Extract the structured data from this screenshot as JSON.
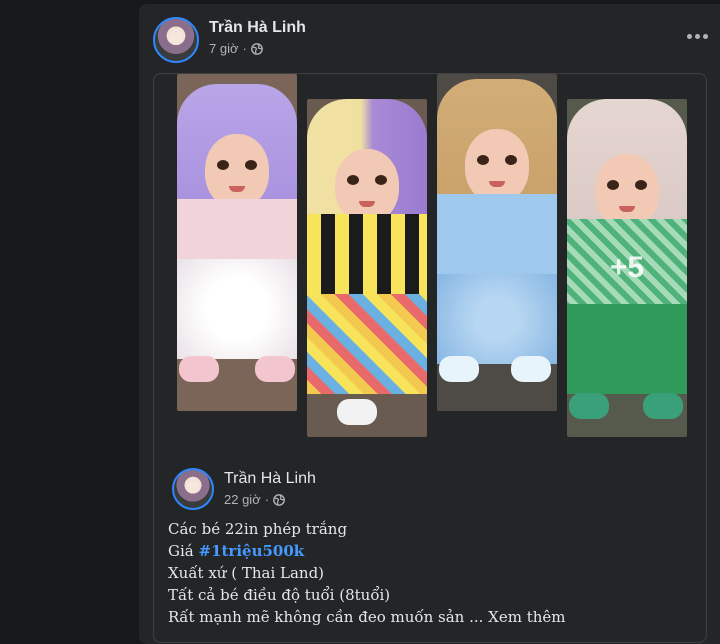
{
  "post": {
    "author": "Trần Hà Linh",
    "time": "7 giờ",
    "privacy_icon": "globe-icon",
    "more_icon": "more-options-icon"
  },
  "shared": {
    "author": "Trần Hà Linh",
    "time": "22 giờ",
    "privacy_icon": "globe-icon",
    "photos_more_label": "+5",
    "caption": {
      "line1": "Các bé 22in phép trắng",
      "line2_prefix": "Giá ",
      "line2_hashtag": "#1triệu500k",
      "line3": "Xuất xứ ( Thai Land)",
      "line4": "Tất cả bé điều độ tuổi (8tuổi)",
      "line5_text": "Rất mạnh mẽ không cần đeo muốn sản ...",
      "see_more": "Xem thêm"
    }
  },
  "colors": {
    "background": "#18191a",
    "card": "#242526",
    "text_primary": "#e4e6eb",
    "text_secondary": "#b0b3b8",
    "hashtag": "#4599ff"
  }
}
